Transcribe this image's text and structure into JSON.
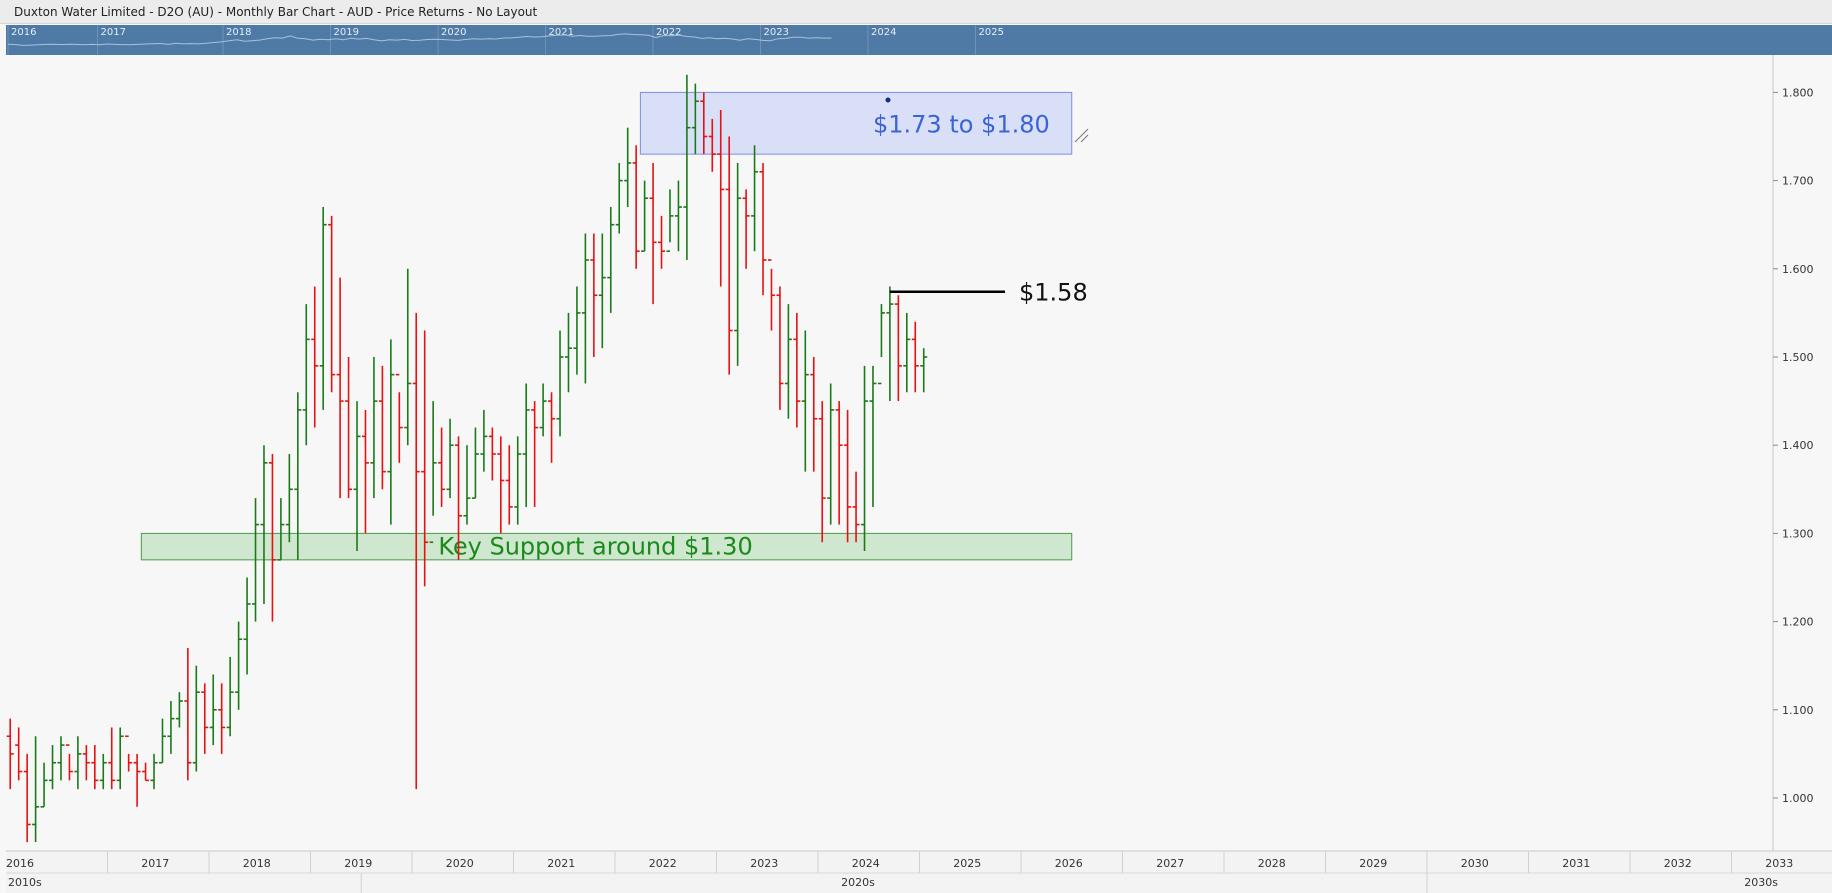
{
  "window": {
    "title": "Duxton Water Limited - D2O (AU) - Monthly Bar Chart - AUD - Price Returns - No Layout"
  },
  "navigator": {
    "year_labels": [
      "2016",
      "2017",
      "2018",
      "2019",
      "2020",
      "2021",
      "2022",
      "2023",
      "2024",
      "2025"
    ]
  },
  "axis": {
    "y_ticks": [
      "1.000",
      "1.100",
      "1.200",
      "1.300",
      "1.400",
      "1.500",
      "1.600",
      "1.700",
      "1.800"
    ],
    "x_years": [
      "2016",
      "2017",
      "2018",
      "2019",
      "2020",
      "2021",
      "2022",
      "2023",
      "2024",
      "2025",
      "2026",
      "2027",
      "2028",
      "2029",
      "2030",
      "2031",
      "2032",
      "2033"
    ],
    "decades": [
      "2010s",
      "2020s",
      "2030s"
    ]
  },
  "colors": {
    "up": "#1a7a1a",
    "down": "#e81010",
    "neutral": "#1010e0",
    "resistance_fill": "#d5dcf5",
    "resistance_stroke": "#7b8fe0",
    "resistance_text": "#3a63d8",
    "support_fill": "#c9e4c9",
    "support_stroke": "#4e9a4e",
    "support_text": "#1a8a1a",
    "navigator_bg": "#4f7aa5"
  },
  "chart_data": {
    "type": "ohlc",
    "title": "Duxton Water Limited - D2O (AU) - Monthly Bar Chart - AUD - Price Returns - No Layout",
    "ylim": [
      0.95,
      1.83
    ],
    "xlim": [
      "2016-01",
      "2034-01"
    ],
    "grid": false,
    "columns": [
      "date",
      "open",
      "high",
      "low",
      "close"
    ],
    "bars": [
      [
        "2016-01",
        1.07,
        1.09,
        1.01,
        1.05
      ],
      [
        "2016-02",
        1.06,
        1.08,
        1.02,
        1.03
      ],
      [
        "2016-03",
        1.03,
        1.05,
        0.95,
        0.97
      ],
      [
        "2016-04",
        0.97,
        1.07,
        0.95,
        0.99
      ],
      [
        "2016-05",
        0.99,
        1.04,
        0.99,
        1.02
      ],
      [
        "2016-06",
        1.02,
        1.06,
        1.01,
        1.04
      ],
      [
        "2016-07",
        1.04,
        1.07,
        1.02,
        1.06
      ],
      [
        "2016-08",
        1.06,
        1.05,
        1.02,
        1.03
      ],
      [
        "2016-09",
        1.03,
        1.07,
        1.01,
        1.05
      ],
      [
        "2016-10",
        1.05,
        1.06,
        1.02,
        1.04
      ],
      [
        "2016-11",
        1.04,
        1.06,
        1.01,
        1.02
      ],
      [
        "2016-12",
        1.02,
        1.05,
        1.01,
        1.04
      ],
      [
        "2017-01",
        1.04,
        1.08,
        1.01,
        1.02
      ],
      [
        "2017-02",
        1.02,
        1.08,
        1.01,
        1.07
      ],
      [
        "2017-03",
        1.07,
        1.05,
        1.03,
        1.04
      ],
      [
        "2017-04",
        1.04,
        1.05,
        0.99,
        1.03
      ],
      [
        "2017-05",
        1.03,
        1.04,
        1.02,
        1.02
      ],
      [
        "2017-06",
        1.02,
        1.05,
        1.01,
        1.04
      ],
      [
        "2017-07",
        1.04,
        1.09,
        1.04,
        1.07
      ],
      [
        "2017-08",
        1.07,
        1.11,
        1.05,
        1.09
      ],
      [
        "2017-09",
        1.09,
        1.12,
        1.08,
        1.11
      ],
      [
        "2017-10",
        1.11,
        1.17,
        1.02,
        1.04
      ],
      [
        "2017-11",
        1.04,
        1.15,
        1.03,
        1.12
      ],
      [
        "2017-12",
        1.12,
        1.13,
        1.05,
        1.08
      ],
      [
        "2018-01",
        1.08,
        1.14,
        1.06,
        1.1
      ],
      [
        "2018-02",
        1.1,
        1.13,
        1.05,
        1.08
      ],
      [
        "2018-03",
        1.08,
        1.16,
        1.07,
        1.12
      ],
      [
        "2018-04",
        1.12,
        1.2,
        1.1,
        1.18
      ],
      [
        "2018-05",
        1.18,
        1.25,
        1.14,
        1.22
      ],
      [
        "2018-06",
        1.22,
        1.34,
        1.2,
        1.31
      ],
      [
        "2018-07",
        1.31,
        1.4,
        1.22,
        1.38
      ],
      [
        "2018-08",
        1.38,
        1.39,
        1.2,
        1.27
      ],
      [
        "2018-09",
        1.27,
        1.34,
        1.27,
        1.31
      ],
      [
        "2018-10",
        1.31,
        1.39,
        1.29,
        1.35
      ],
      [
        "2018-11",
        1.35,
        1.46,
        1.27,
        1.44
      ],
      [
        "2018-12",
        1.44,
        1.56,
        1.4,
        1.52
      ],
      [
        "2019-01",
        1.52,
        1.58,
        1.42,
        1.49
      ],
      [
        "2019-02",
        1.49,
        1.67,
        1.44,
        1.65
      ],
      [
        "2019-03",
        1.65,
        1.66,
        1.46,
        1.48
      ],
      [
        "2019-04",
        1.48,
        1.59,
        1.34,
        1.45
      ],
      [
        "2019-05",
        1.45,
        1.5,
        1.34,
        1.35
      ],
      [
        "2019-06",
        1.35,
        1.45,
        1.28,
        1.41
      ],
      [
        "2019-07",
        1.41,
        1.44,
        1.3,
        1.38
      ],
      [
        "2019-08",
        1.38,
        1.5,
        1.34,
        1.45
      ],
      [
        "2019-09",
        1.45,
        1.49,
        1.35,
        1.37
      ],
      [
        "2019-10",
        1.37,
        1.52,
        1.31,
        1.48
      ],
      [
        "2019-11",
        1.48,
        1.46,
        1.38,
        1.42
      ],
      [
        "2019-12",
        1.42,
        1.6,
        1.4,
        1.47
      ],
      [
        "2020-01",
        1.47,
        1.55,
        1.01,
        1.37
      ],
      [
        "2020-02",
        1.37,
        1.53,
        1.24,
        1.29
      ],
      [
        "2020-03",
        1.29,
        1.45,
        1.32,
        1.38
      ],
      [
        "2020-04",
        1.38,
        1.42,
        1.33,
        1.35
      ],
      [
        "2020-05",
        1.35,
        1.43,
        1.34,
        1.4
      ],
      [
        "2020-06",
        1.4,
        1.41,
        1.27,
        1.32
      ],
      [
        "2020-07",
        1.32,
        1.4,
        1.31,
        1.34
      ],
      [
        "2020-08",
        1.34,
        1.42,
        1.34,
        1.39
      ],
      [
        "2020-09",
        1.39,
        1.44,
        1.37,
        1.41
      ],
      [
        "2020-10",
        1.41,
        1.42,
        1.36,
        1.39
      ],
      [
        "2020-11",
        1.39,
        1.41,
        1.3,
        1.36
      ],
      [
        "2020-12",
        1.36,
        1.4,
        1.31,
        1.33
      ],
      [
        "2021-01",
        1.33,
        1.41,
        1.31,
        1.39
      ],
      [
        "2021-02",
        1.39,
        1.47,
        1.33,
        1.44
      ],
      [
        "2021-03",
        1.44,
        1.45,
        1.33,
        1.42
      ],
      [
        "2021-04",
        1.42,
        1.47,
        1.41,
        1.45
      ],
      [
        "2021-05",
        1.45,
        1.46,
        1.38,
        1.43
      ],
      [
        "2021-06",
        1.43,
        1.53,
        1.41,
        1.5
      ],
      [
        "2021-07",
        1.5,
        1.55,
        1.46,
        1.51
      ],
      [
        "2021-08",
        1.51,
        1.58,
        1.48,
        1.55
      ],
      [
        "2021-09",
        1.55,
        1.64,
        1.47,
        1.61
      ],
      [
        "2021-10",
        1.61,
        1.64,
        1.5,
        1.57
      ],
      [
        "2021-11",
        1.57,
        1.64,
        1.51,
        1.59
      ],
      [
        "2021-12",
        1.59,
        1.67,
        1.55,
        1.65
      ],
      [
        "2022-01",
        1.65,
        1.72,
        1.64,
        1.7
      ],
      [
        "2022-02",
        1.7,
        1.76,
        1.67,
        1.72
      ],
      [
        "2022-03",
        1.72,
        1.74,
        1.6,
        1.62
      ],
      [
        "2022-04",
        1.62,
        1.7,
        1.62,
        1.68
      ],
      [
        "2022-05",
        1.68,
        1.72,
        1.56,
        1.63
      ],
      [
        "2022-06",
        1.63,
        1.66,
        1.6,
        1.62
      ],
      [
        "2022-07",
        1.62,
        1.69,
        1.63,
        1.66
      ],
      [
        "2022-08",
        1.66,
        1.7,
        1.62,
        1.67
      ],
      [
        "2022-09",
        1.67,
        1.82,
        1.61,
        1.76
      ],
      [
        "2022-10",
        1.76,
        1.81,
        1.73,
        1.79
      ],
      [
        "2022-11",
        1.79,
        1.8,
        1.73,
        1.75
      ],
      [
        "2022-12",
        1.75,
        1.77,
        1.71,
        1.73
      ],
      [
        "2023-01",
        1.73,
        1.78,
        1.58,
        1.69
      ],
      [
        "2023-02",
        1.69,
        1.75,
        1.48,
        1.53
      ],
      [
        "2023-03",
        1.53,
        1.72,
        1.49,
        1.68
      ],
      [
        "2023-04",
        1.68,
        1.69,
        1.6,
        1.66
      ],
      [
        "2023-05",
        1.66,
        1.74,
        1.62,
        1.71
      ],
      [
        "2023-06",
        1.71,
        1.72,
        1.57,
        1.61
      ],
      [
        "2023-07",
        1.61,
        1.6,
        1.53,
        1.57
      ],
      [
        "2023-08",
        1.57,
        1.58,
        1.44,
        1.47
      ],
      [
        "2023-09",
        1.47,
        1.56,
        1.43,
        1.52
      ],
      [
        "2023-10",
        1.52,
        1.55,
        1.42,
        1.45
      ],
      [
        "2023-11",
        1.45,
        1.53,
        1.37,
        1.48
      ],
      [
        "2023-12",
        1.48,
        1.5,
        1.37,
        1.43
      ],
      [
        "2024-01",
        1.43,
        1.45,
        1.29,
        1.34
      ],
      [
        "2024-02",
        1.34,
        1.47,
        1.31,
        1.44
      ],
      [
        "2024-03",
        1.44,
        1.45,
        1.31,
        1.4
      ],
      [
        "2024-04",
        1.4,
        1.44,
        1.29,
        1.33
      ],
      [
        "2024-05",
        1.33,
        1.37,
        1.29,
        1.31
      ],
      [
        "2024-06",
        1.31,
        1.49,
        1.28,
        1.45
      ],
      [
        "2024-07",
        1.45,
        1.49,
        1.33,
        1.47
      ],
      [
        "2024-08",
        1.47,
        1.56,
        1.5,
        1.55
      ],
      [
        "2024-09",
        1.55,
        1.58,
        1.45,
        1.56
      ],
      [
        "2024-10",
        1.56,
        1.57,
        1.45,
        1.49
      ],
      [
        "2024-11",
        1.49,
        1.55,
        1.46,
        1.52
      ],
      [
        "2024-12",
        1.52,
        1.54,
        1.46,
        1.49
      ],
      [
        "2025-01",
        1.49,
        1.51,
        1.46,
        1.5
      ]
    ],
    "annotations": [
      {
        "type": "zone",
        "label": "$1.73 to $1.80",
        "low": 1.73,
        "high": 1.8,
        "from": "2022-04",
        "to": "2026-07"
      },
      {
        "type": "zone",
        "label": "Key Support around $1.30",
        "low": 1.27,
        "high": 1.3,
        "from": "2017-05",
        "to": "2026-07"
      },
      {
        "type": "level",
        "label": "$1.58",
        "value": 1.574,
        "from": "2024-09",
        "to": "2025-12"
      }
    ]
  }
}
